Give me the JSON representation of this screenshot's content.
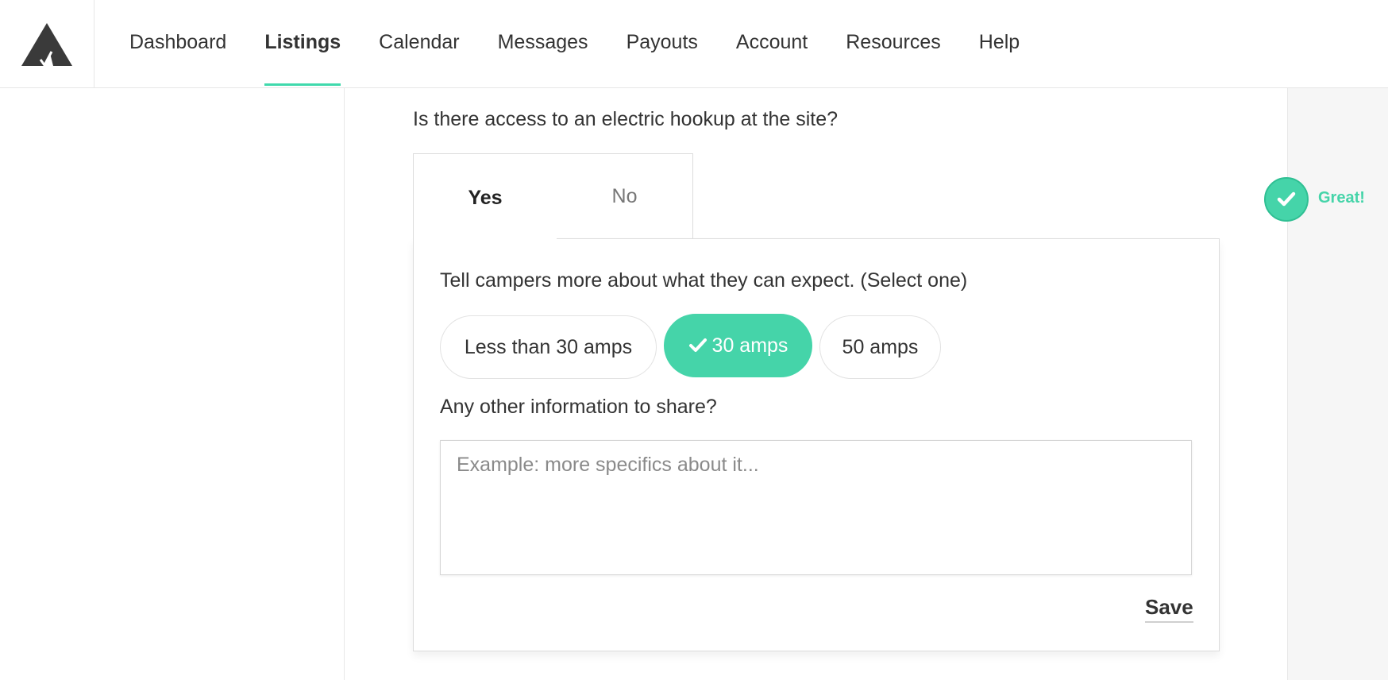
{
  "nav": {
    "logo": "tent-logo-icon",
    "items": [
      {
        "label": "Dashboard",
        "active": false
      },
      {
        "label": "Listings",
        "active": true
      },
      {
        "label": "Calendar",
        "active": false
      },
      {
        "label": "Messages",
        "active": false
      },
      {
        "label": "Payouts",
        "active": false
      },
      {
        "label": "Account",
        "active": false
      },
      {
        "label": "Resources",
        "active": false
      },
      {
        "label": "Help",
        "active": false
      }
    ],
    "active_color": "#40d9ac"
  },
  "form": {
    "question": "Is there access to an electric hookup at the site?",
    "tabs": {
      "yes": "Yes",
      "no": "No",
      "selected": "yes"
    },
    "sub_question": "Tell campers more about what they can expect. (Select one)",
    "options": [
      {
        "label": "Less than 30 amps",
        "selected": false
      },
      {
        "label": "30 amps",
        "selected": true
      },
      {
        "label": "50 amps",
        "selected": false
      }
    ],
    "other_label": "Any other information to share?",
    "notes_placeholder": "Example: more specifics about it...",
    "notes_value": "",
    "save_label": "Save"
  },
  "status": {
    "text": "Great!",
    "icon": "check-icon",
    "color": "#45d4a9"
  }
}
